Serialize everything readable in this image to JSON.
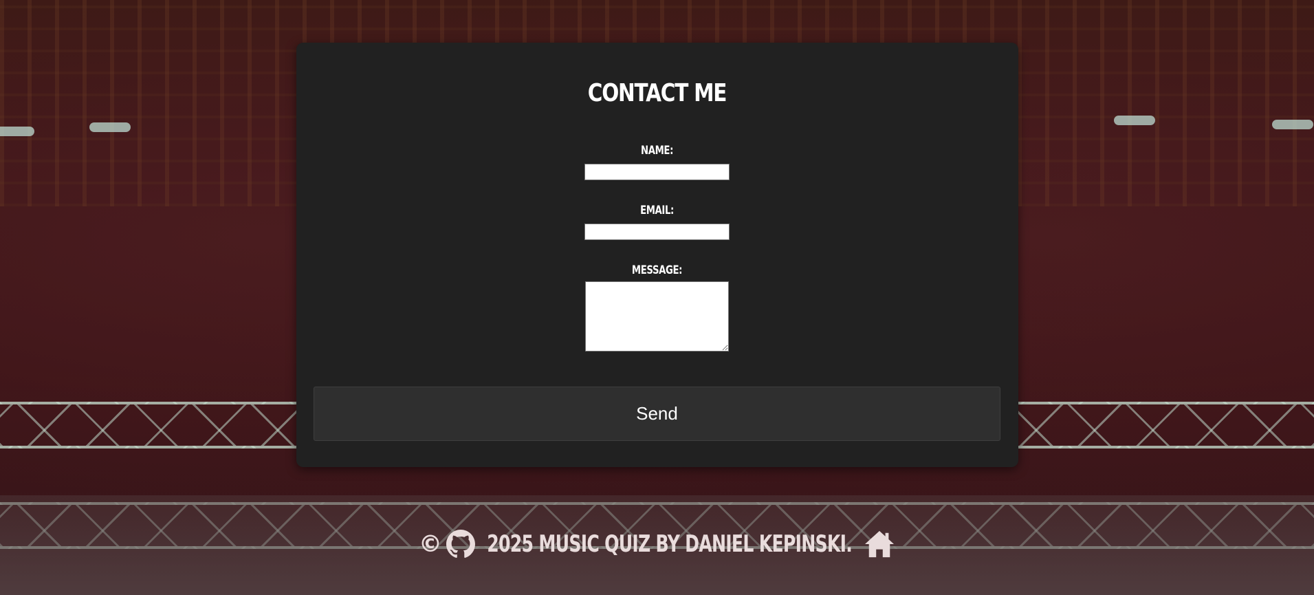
{
  "form": {
    "title": "CONTACT ME",
    "name_label": "NAME:",
    "email_label": "EMAIL:",
    "message_label": "MESSAGE:",
    "name_value": "",
    "email_value": "",
    "message_value": "",
    "send_label": "Send"
  },
  "footer": {
    "copyright_symbol": "©",
    "text": "2025 MUSIC QUIZ BY DANIEL KEPINSKI.",
    "icons": [
      "github-icon",
      "home-icon"
    ]
  },
  "colors": {
    "card_background": "#212121",
    "button_background": "#2f2f2f",
    "text": "#ffffff",
    "footer_text": "#e9dcdc"
  }
}
